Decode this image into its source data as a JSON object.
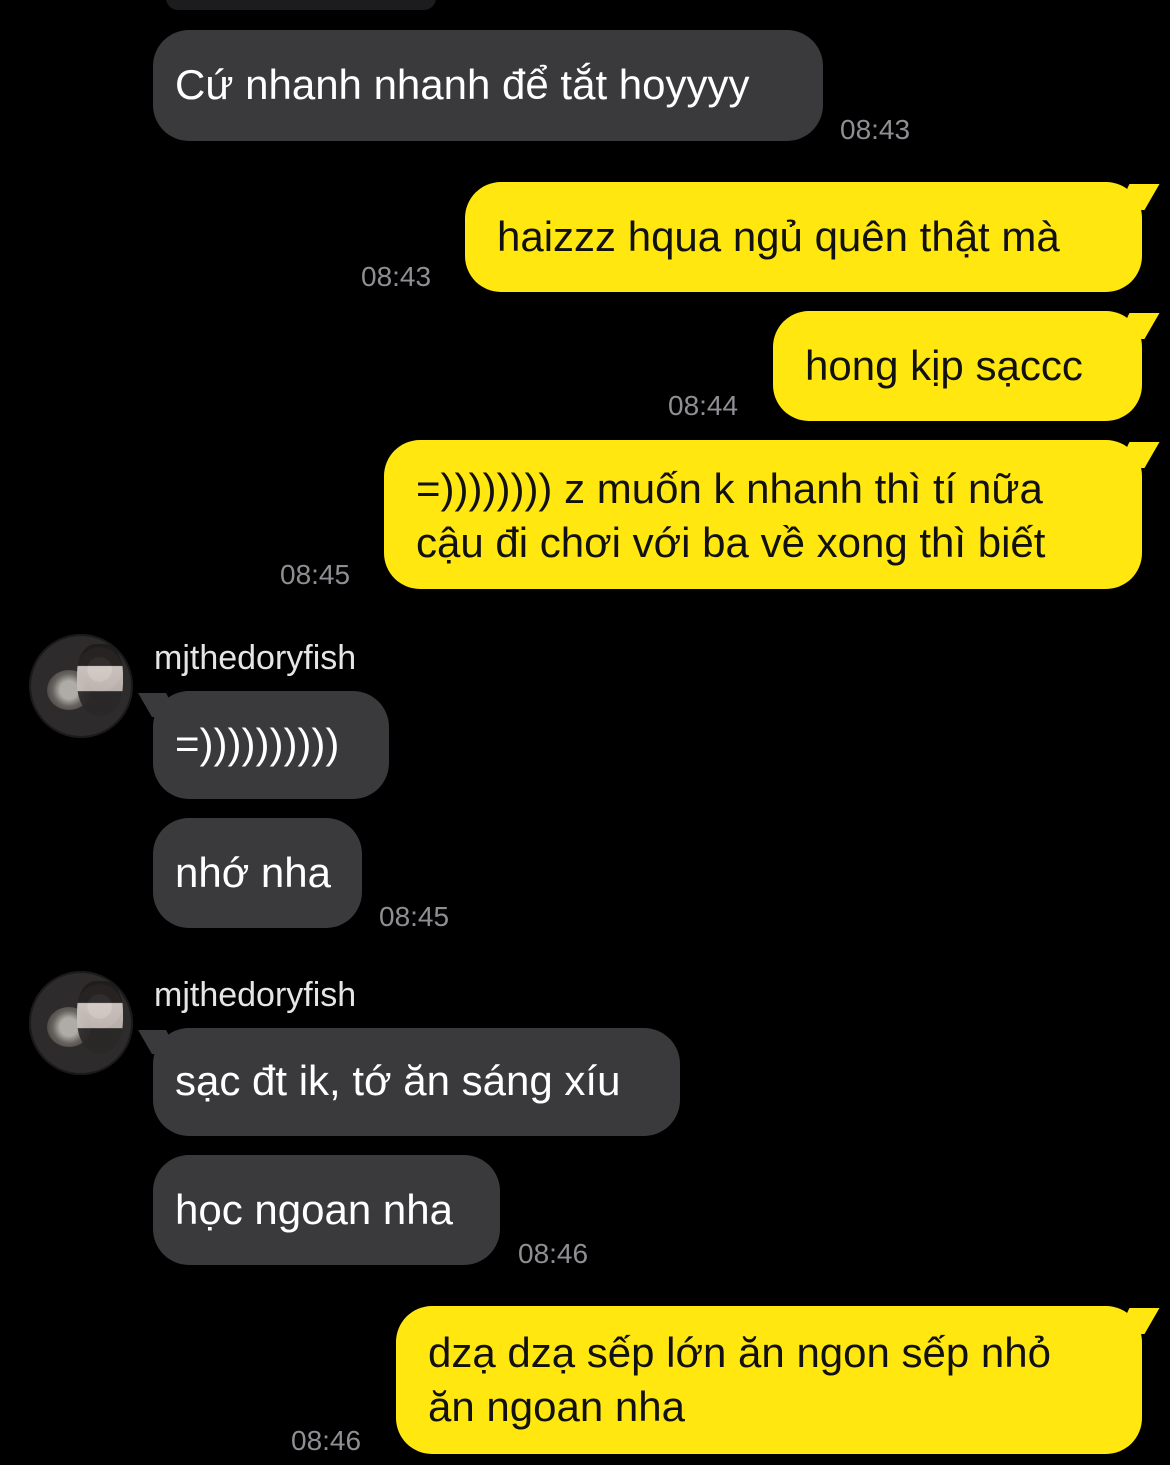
{
  "contact": {
    "username": "mjthedoryfish",
    "avatar_icon": "profile-photo-avatar"
  },
  "colors": {
    "background": "#000000",
    "incoming_bubble": "#3a3a3c",
    "outgoing_bubble": "#ffe70f",
    "timestamp": "#8e8e93"
  },
  "messages": [
    {
      "direction": "in",
      "text": "Cứ nhanh nhanh để tắt hoyyyy",
      "time": "08:43"
    },
    {
      "direction": "out",
      "text": "haizzz hqua ngủ quên thật mà",
      "time": "08:43"
    },
    {
      "direction": "out",
      "text": "hong kịp sạccc",
      "time": "08:44"
    },
    {
      "direction": "out",
      "line1": "=)))))))) z muốn k nhanh thì tí nữa",
      "line2": "cậu đi chơi với ba về xong thì biết",
      "time": "08:45"
    },
    {
      "direction": "in",
      "sender": "mjthedoryfish",
      "text": "=))))))))))"
    },
    {
      "direction": "in",
      "text": "nhớ nha",
      "time": "08:45"
    },
    {
      "direction": "in",
      "sender": "mjthedoryfish",
      "text": "sạc đt ik, tớ ăn sáng xíu"
    },
    {
      "direction": "in",
      "text": "học ngoan nha",
      "time": "08:46"
    },
    {
      "direction": "out",
      "line1": "dzạ dzạ sếp lớn ăn ngon sếp nhỏ",
      "line2": "ăn ngoan nha",
      "time": "08:46"
    }
  ]
}
